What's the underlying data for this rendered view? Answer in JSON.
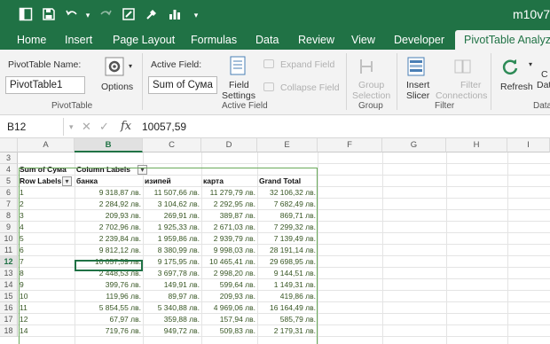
{
  "titlebar": {
    "document": "m10v7"
  },
  "tabs": [
    {
      "label": "Home"
    },
    {
      "label": "Insert"
    },
    {
      "label": "Page Layout"
    },
    {
      "label": "Formulas"
    },
    {
      "label": "Data"
    },
    {
      "label": "Review"
    },
    {
      "label": "View"
    },
    {
      "label": "Developer"
    },
    {
      "label": "PivotTable Analyze"
    }
  ],
  "ribbon": {
    "pivot_name_label": "PivotTable Name:",
    "pivot_name_value": "PivotTable1",
    "options_label": "Options",
    "group_pivottable": "PivotTable",
    "active_field_label": "Active Field:",
    "active_field_value": "Sum of Сума",
    "field_settings_label1": "Field",
    "field_settings_label2": "Settings",
    "expand_field_label": "Expand Field",
    "collapse_field_label": "Collapse Field",
    "group_active_field": "Active Field",
    "group_selection_label1": "Group",
    "group_selection_label2": "Selection",
    "group_group": "Group",
    "insert_slicer_label1": "Insert",
    "insert_slicer_label2": "Slicer",
    "filter_connections_label1": "Filter",
    "filter_connections_label2": "Connections",
    "group_filter": "Filter",
    "refresh_label": "Refresh",
    "change_label1": "C",
    "change_label2": "Dat",
    "group_data": "Data"
  },
  "formula_bar": {
    "name_box": "B12",
    "fx": "fx",
    "value": "10057,59"
  },
  "columns": [
    "A",
    "B",
    "C",
    "D",
    "E",
    "F",
    "G",
    "H",
    "I"
  ],
  "selected_column": "B",
  "pivot": {
    "corner": "Sum of Сума",
    "column_labels": "Column Labels",
    "row_labels": "Row Labels",
    "headers": [
      "банка",
      "изипей",
      "карта",
      "Grand Total"
    ],
    "rows": [
      {
        "row": "6",
        "label": "1",
        "vals": [
          "9 318,87 лв.",
          "11 507,66 лв.",
          "11 279,79 лв.",
          "32 106,32 лв."
        ]
      },
      {
        "row": "7",
        "label": "2",
        "vals": [
          "2 284,92 лв.",
          "3 104,62 лв.",
          "2 292,95 лв.",
          "7 682,49 лв."
        ]
      },
      {
        "row": "8",
        "label": "3",
        "vals": [
          "209,93 лв.",
          "269,91 лв.",
          "389,87 лв.",
          "869,71 лв."
        ]
      },
      {
        "row": "9",
        "label": "4",
        "vals": [
          "2 702,96 лв.",
          "1 925,33 лв.",
          "2 671,03 лв.",
          "7 299,32 лв."
        ]
      },
      {
        "row": "10",
        "label": "5",
        "vals": [
          "2 239,84 лв.",
          "1 959,86 лв.",
          "2 939,79 лв.",
          "7 139,49 лв."
        ]
      },
      {
        "row": "11",
        "label": "6",
        "vals": [
          "9 812,12 лв.",
          "8 380,99 лв.",
          "9 998,03 лв.",
          "28 191,14 лв."
        ]
      },
      {
        "row": "12",
        "label": "7",
        "vals": [
          "10 057,59 лв.",
          "9 175,95 лв.",
          "10 465,41 лв.",
          "29 698,95 лв."
        ]
      },
      {
        "row": "13",
        "label": "8",
        "vals": [
          "2 448,53 лв.",
          "3 697,78 лв.",
          "2 998,20 лв.",
          "9 144,51 лв."
        ]
      },
      {
        "row": "14",
        "label": "9",
        "vals": [
          "399,76 лв.",
          "149,91 лв.",
          "599,64 лв.",
          "1 149,31 лв."
        ]
      },
      {
        "row": "15",
        "label": "10",
        "vals": [
          "119,96 лв.",
          "89,97 лв.",
          "209,93 лв.",
          "419,86 лв."
        ]
      },
      {
        "row": "16",
        "label": "11",
        "vals": [
          "5 854,55 лв.",
          "5 340,88 лв.",
          "4 969,06 лв.",
          "16 164,49 лв."
        ]
      },
      {
        "row": "17",
        "label": "12",
        "vals": [
          "67,97 лв.",
          "359,88 лв.",
          "157,94 лв.",
          "585,79 лв."
        ]
      },
      {
        "row": "18",
        "label": "14",
        "vals": [
          "719,76 лв.",
          "949,72 лв.",
          "509,83 лв.",
          "2 179,31 лв."
        ]
      }
    ]
  }
}
